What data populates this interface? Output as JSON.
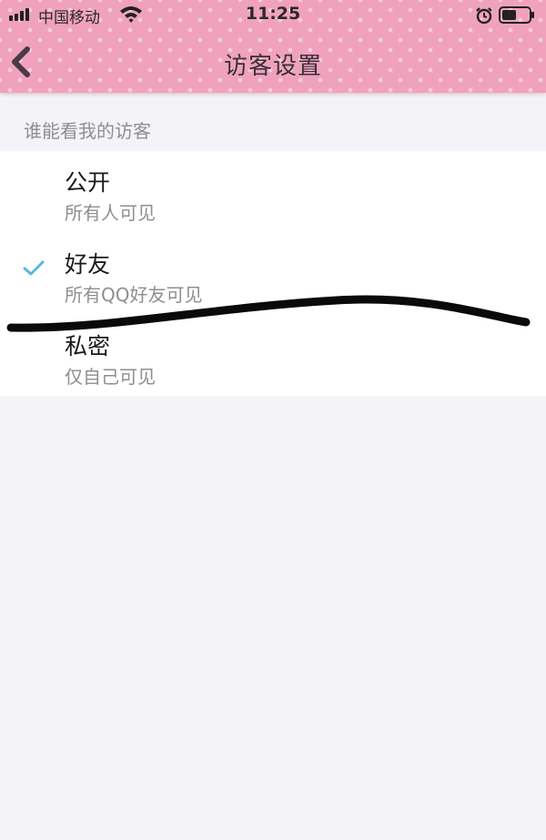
{
  "status_bar": {
    "carrier": "中国移动",
    "time": "11:25",
    "icons": [
      "signal-bars-icon",
      "wifi-icon",
      "alarm-clock-icon",
      "battery-icon"
    ]
  },
  "nav": {
    "back_icon": "chevron-left-icon",
    "title": "访客设置"
  },
  "section": {
    "header": "谁能看我的访客"
  },
  "options": [
    {
      "title": "公开",
      "desc": "所有人可见",
      "selected": false
    },
    {
      "title": "好友",
      "desc": "所有QQ好友可见",
      "selected": true
    },
    {
      "title": "私密",
      "desc": "仅自己可见",
      "selected": false
    }
  ],
  "colors": {
    "header_pink": "#f0a2bd",
    "check_blue": "#5ab8d8",
    "page_bg": "#f4f4f8",
    "secondary_text": "#8e8e93"
  },
  "annotation": "black-marker-scribble"
}
